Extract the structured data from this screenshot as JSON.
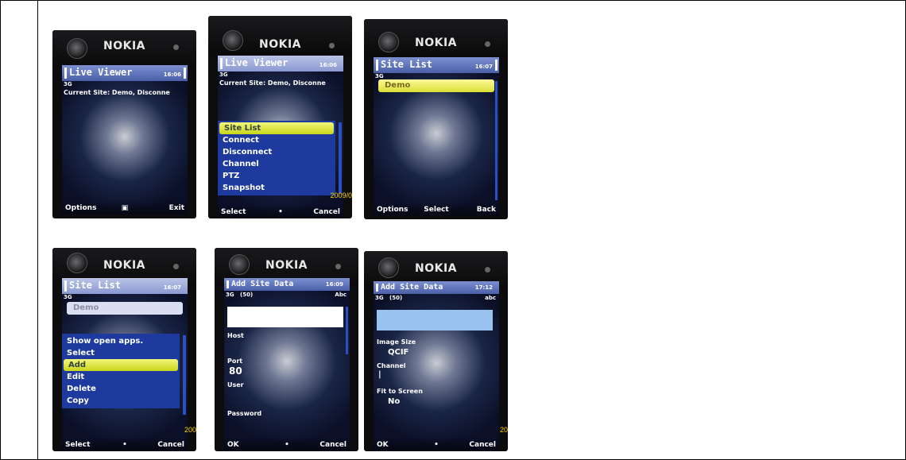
{
  "layout_colors": {
    "menu_bg": "#1e3a9e",
    "highlight": "#e4ea48",
    "title_bg": "#5a6fb8",
    "date_stamp": "#ffd400"
  },
  "phones": [
    {
      "brand": "NOKIA",
      "title": "Live Viewer",
      "time": "16:06",
      "network": "3G",
      "info": "Current Site: Demo, Disconne",
      "softkeys": {
        "left": "Options",
        "middle": "▣",
        "right": "Exit"
      }
    },
    {
      "brand": "NOKIA",
      "title": "Live Viewer",
      "time": "16:06",
      "network": "3G",
      "info": "Current Site: Demo, Disconne",
      "menu": [
        "Site List",
        "Connect",
        "Disconnect",
        "Channel",
        "PTZ",
        "Snapshot"
      ],
      "menu_selected": "Site List",
      "softkeys": {
        "left": "Select",
        "middle": "•",
        "right": "Cancel"
      },
      "date_stamp": "2009/0"
    },
    {
      "brand": "NOKIA",
      "title": "Site List",
      "time": "16:07",
      "network": "3G",
      "list_item": "Demo",
      "softkeys": {
        "left": "Options",
        "middle": "Select",
        "right": "Back"
      }
    },
    {
      "brand": "NOKIA",
      "title": "Site List",
      "time": "16:07",
      "network": "3G",
      "list_item": "Demo",
      "menu": [
        "Show open apps.",
        "Select",
        "Add",
        "Edit",
        "Delete",
        "Copy"
      ],
      "menu_selected": "Add",
      "softkeys": {
        "left": "Select",
        "middle": "•",
        "right": "Cancel"
      },
      "date_stamp": "200"
    },
    {
      "brand": "NOKIA",
      "title": "Add Site Data",
      "time": "16:09",
      "network": "3G",
      "chars": "(50)",
      "input_mode": "Abc",
      "fields": {
        "host_label": "Host",
        "port_label": "Port",
        "port_value": "80",
        "user_label": "User",
        "password_label": "Password"
      },
      "softkeys": {
        "left": "OK",
        "middle": "•",
        "right": "Cancel"
      }
    },
    {
      "brand": "NOKIA",
      "title": "Add Site Data",
      "time": "17:12",
      "network": "3G",
      "chars": "(50)",
      "input_mode": "abc",
      "fields": {
        "image_size_label": "Image Size",
        "image_size_value": "QCIF",
        "channel_label": "Channel",
        "channel_value": "|",
        "fit_label": "Fit to Screen",
        "fit_value": "No"
      },
      "softkeys": {
        "left": "OK",
        "middle": "•",
        "right": "Cancel"
      },
      "date_stamp": "20"
    }
  ]
}
